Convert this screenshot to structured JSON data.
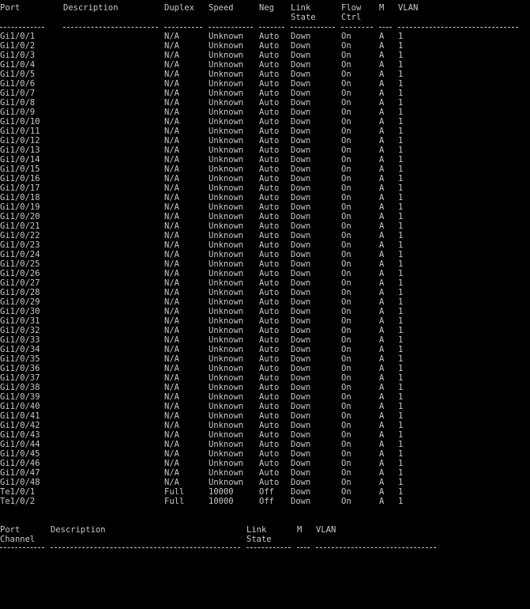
{
  "interfaces": {
    "headers": {
      "port": "Port",
      "description": "Description",
      "duplex": "Duplex",
      "speed": "Speed",
      "neg": "Neg",
      "link1": "Link",
      "link2": "State",
      "flow1": "Flow",
      "flow2": "Ctrl",
      "m": "M",
      "vlan": "VLAN"
    },
    "rows": [
      [
        "Gi1/0/1",
        "N/A",
        "Unknown",
        "Auto",
        "Down",
        "On",
        "A",
        "1"
      ],
      [
        "Gi1/0/2",
        "N/A",
        "Unknown",
        "Auto",
        "Down",
        "On",
        "A",
        "1"
      ],
      [
        "Gi1/0/3",
        "N/A",
        "Unknown",
        "Auto",
        "Down",
        "On",
        "A",
        "1"
      ],
      [
        "Gi1/0/4",
        "N/A",
        "Unknown",
        "Auto",
        "Down",
        "On",
        "A",
        "1"
      ],
      [
        "Gi1/0/5",
        "N/A",
        "Unknown",
        "Auto",
        "Down",
        "On",
        "A",
        "1"
      ],
      [
        "Gi1/0/6",
        "N/A",
        "Unknown",
        "Auto",
        "Down",
        "On",
        "A",
        "1"
      ],
      [
        "Gi1/0/7",
        "N/A",
        "Unknown",
        "Auto",
        "Down",
        "On",
        "A",
        "1"
      ],
      [
        "Gi1/0/8",
        "N/A",
        "Unknown",
        "Auto",
        "Down",
        "On",
        "A",
        "1"
      ],
      [
        "Gi1/0/9",
        "N/A",
        "Unknown",
        "Auto",
        "Down",
        "On",
        "A",
        "1"
      ],
      [
        "Gi1/0/10",
        "N/A",
        "Unknown",
        "Auto",
        "Down",
        "On",
        "A",
        "1"
      ],
      [
        "Gi1/0/11",
        "N/A",
        "Unknown",
        "Auto",
        "Down",
        "On",
        "A",
        "1"
      ],
      [
        "Gi1/0/12",
        "N/A",
        "Unknown",
        "Auto",
        "Down",
        "On",
        "A",
        "1"
      ],
      [
        "Gi1/0/13",
        "N/A",
        "Unknown",
        "Auto",
        "Down",
        "On",
        "A",
        "1"
      ],
      [
        "Gi1/0/14",
        "N/A",
        "Unknown",
        "Auto",
        "Down",
        "On",
        "A",
        "1"
      ],
      [
        "Gi1/0/15",
        "N/A",
        "Unknown",
        "Auto",
        "Down",
        "On",
        "A",
        "1"
      ],
      [
        "Gi1/0/16",
        "N/A",
        "Unknown",
        "Auto",
        "Down",
        "On",
        "A",
        "1"
      ],
      [
        "Gi1/0/17",
        "N/A",
        "Unknown",
        "Auto",
        "Down",
        "On",
        "A",
        "1"
      ],
      [
        "Gi1/0/18",
        "N/A",
        "Unknown",
        "Auto",
        "Down",
        "On",
        "A",
        "1"
      ],
      [
        "Gi1/0/19",
        "N/A",
        "Unknown",
        "Auto",
        "Down",
        "On",
        "A",
        "1"
      ],
      [
        "Gi1/0/20",
        "N/A",
        "Unknown",
        "Auto",
        "Down",
        "On",
        "A",
        "1"
      ],
      [
        "Gi1/0/21",
        "N/A",
        "Unknown",
        "Auto",
        "Down",
        "On",
        "A",
        "1"
      ],
      [
        "Gi1/0/22",
        "N/A",
        "Unknown",
        "Auto",
        "Down",
        "On",
        "A",
        "1"
      ],
      [
        "Gi1/0/23",
        "N/A",
        "Unknown",
        "Auto",
        "Down",
        "On",
        "A",
        "1"
      ],
      [
        "Gi1/0/24",
        "N/A",
        "Unknown",
        "Auto",
        "Down",
        "On",
        "A",
        "1"
      ],
      [
        "Gi1/0/25",
        "N/A",
        "Unknown",
        "Auto",
        "Down",
        "On",
        "A",
        "1"
      ],
      [
        "Gi1/0/26",
        "N/A",
        "Unknown",
        "Auto",
        "Down",
        "On",
        "A",
        "1"
      ],
      [
        "Gi1/0/27",
        "N/A",
        "Unknown",
        "Auto",
        "Down",
        "On",
        "A",
        "1"
      ],
      [
        "Gi1/0/28",
        "N/A",
        "Unknown",
        "Auto",
        "Down",
        "On",
        "A",
        "1"
      ],
      [
        "Gi1/0/29",
        "N/A",
        "Unknown",
        "Auto",
        "Down",
        "On",
        "A",
        "1"
      ],
      [
        "Gi1/0/30",
        "N/A",
        "Unknown",
        "Auto",
        "Down",
        "On",
        "A",
        "1"
      ],
      [
        "Gi1/0/31",
        "N/A",
        "Unknown",
        "Auto",
        "Down",
        "On",
        "A",
        "1"
      ],
      [
        "Gi1/0/32",
        "N/A",
        "Unknown",
        "Auto",
        "Down",
        "On",
        "A",
        "1"
      ],
      [
        "Gi1/0/33",
        "N/A",
        "Unknown",
        "Auto",
        "Down",
        "On",
        "A",
        "1"
      ],
      [
        "Gi1/0/34",
        "N/A",
        "Unknown",
        "Auto",
        "Down",
        "On",
        "A",
        "1"
      ],
      [
        "Gi1/0/35",
        "N/A",
        "Unknown",
        "Auto",
        "Down",
        "On",
        "A",
        "1"
      ],
      [
        "Gi1/0/36",
        "N/A",
        "Unknown",
        "Auto",
        "Down",
        "On",
        "A",
        "1"
      ],
      [
        "Gi1/0/37",
        "N/A",
        "Unknown",
        "Auto",
        "Down",
        "On",
        "A",
        "1"
      ],
      [
        "Gi1/0/38",
        "N/A",
        "Unknown",
        "Auto",
        "Down",
        "On",
        "A",
        "1"
      ],
      [
        "Gi1/0/39",
        "N/A",
        "Unknown",
        "Auto",
        "Down",
        "On",
        "A",
        "1"
      ],
      [
        "Gi1/0/40",
        "N/A",
        "Unknown",
        "Auto",
        "Down",
        "On",
        "A",
        "1"
      ],
      [
        "Gi1/0/41",
        "N/A",
        "Unknown",
        "Auto",
        "Down",
        "On",
        "A",
        "1"
      ],
      [
        "Gi1/0/42",
        "N/A",
        "Unknown",
        "Auto",
        "Down",
        "On",
        "A",
        "1"
      ],
      [
        "Gi1/0/43",
        "N/A",
        "Unknown",
        "Auto",
        "Down",
        "On",
        "A",
        "1"
      ],
      [
        "Gi1/0/44",
        "N/A",
        "Unknown",
        "Auto",
        "Down",
        "On",
        "A",
        "1"
      ],
      [
        "Gi1/0/45",
        "N/A",
        "Unknown",
        "Auto",
        "Down",
        "On",
        "A",
        "1"
      ],
      [
        "Gi1/0/46",
        "N/A",
        "Unknown",
        "Auto",
        "Down",
        "On",
        "A",
        "1"
      ],
      [
        "Gi1/0/47",
        "N/A",
        "Unknown",
        "Auto",
        "Down",
        "On",
        "A",
        "1"
      ],
      [
        "Gi1/0/48",
        "N/A",
        "Unknown",
        "Auto",
        "Down",
        "On",
        "A",
        "1"
      ],
      [
        "Te1/0/1",
        "Full",
        "10000",
        "Off",
        "Down",
        "On",
        "A",
        "1"
      ],
      [
        "Te1/0/2",
        "Full",
        "10000",
        "Off",
        "Down",
        "On",
        "A",
        "1"
      ]
    ]
  },
  "port_channel": {
    "headers": {
      "port1": "Port",
      "port2": "Channel",
      "description": "Description",
      "link1": "Link",
      "link2": "State",
      "m": "M",
      "vlan": "VLAN"
    }
  }
}
